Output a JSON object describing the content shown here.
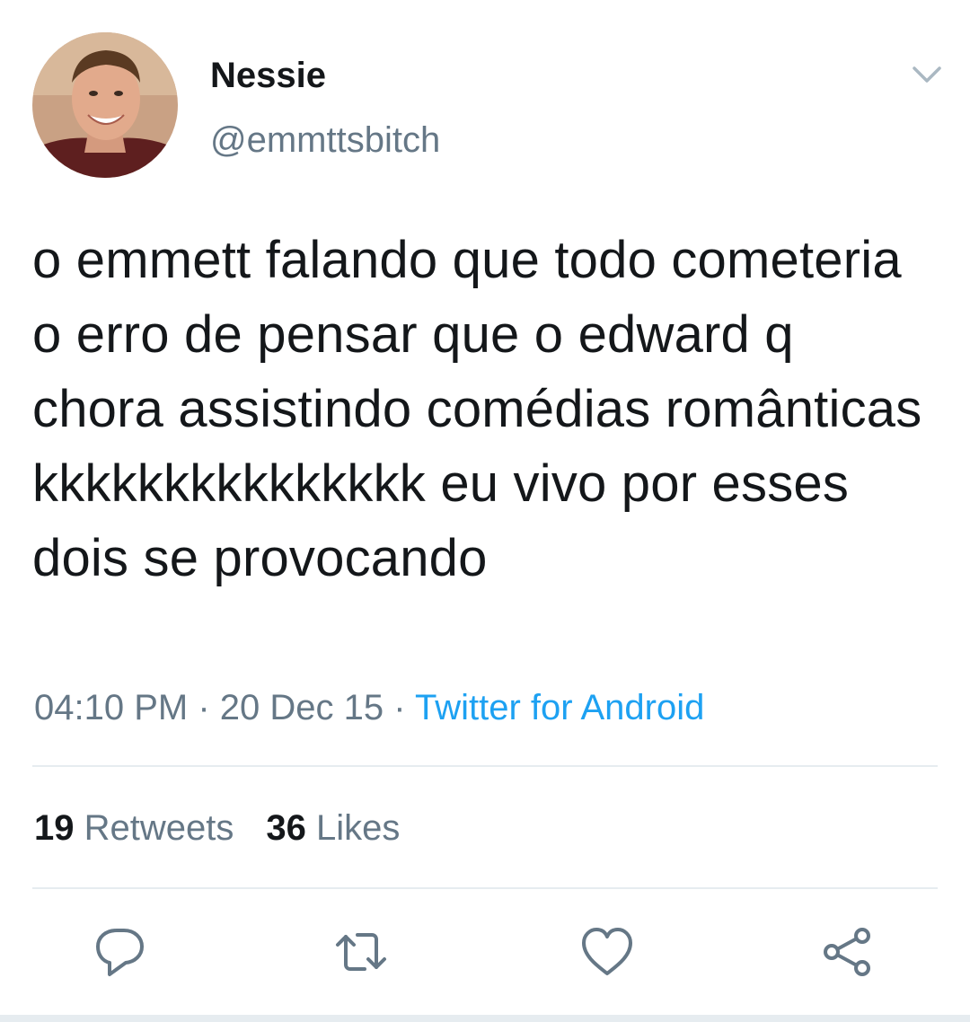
{
  "user": {
    "display_name": "Nessie",
    "handle": "@emmttsbitch",
    "avatar_icon": "profile-photo"
  },
  "tweet": {
    "text": "o emmett falando que todo cometeria o erro de pensar que o edward q chora assistindo comédias românticas kkkkkkkkkkkkkkk eu vivo por esses dois se provocando",
    "time": "04:10 PM",
    "date": "20 Dec 15",
    "separator": "·",
    "source": "Twitter for Android"
  },
  "stats": {
    "retweets_count": "19",
    "retweets_label": "Retweets",
    "likes_count": "36",
    "likes_label": "Likes"
  },
  "actions": [
    "reply-icon",
    "retweet-icon",
    "like-icon",
    "share-icon"
  ],
  "colors": {
    "text": "#14171a",
    "secondary": "#657786",
    "link": "#1da1f2",
    "divider": "#e6ecf0"
  }
}
